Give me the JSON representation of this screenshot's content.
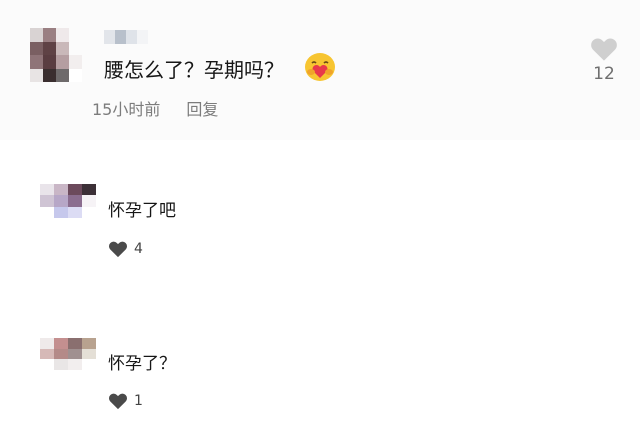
{
  "top_comment": {
    "text": "腰怎么了？孕期吗？",
    "time": "15小时前",
    "reply_label": "回复",
    "like_count": "12",
    "emoji": "hugging-heart-emoji"
  },
  "replies": [
    {
      "text": "怀孕了吧",
      "like_count": "4"
    },
    {
      "text": "怀孕了？",
      "like_count": "1"
    }
  ],
  "icons": {
    "like": "heart-icon"
  },
  "colors": {
    "like_outline": "#c9c9c9",
    "like_filled": "#4a4a4a",
    "emoji_face": "#f7c531",
    "emoji_heart": "#e8394a"
  }
}
